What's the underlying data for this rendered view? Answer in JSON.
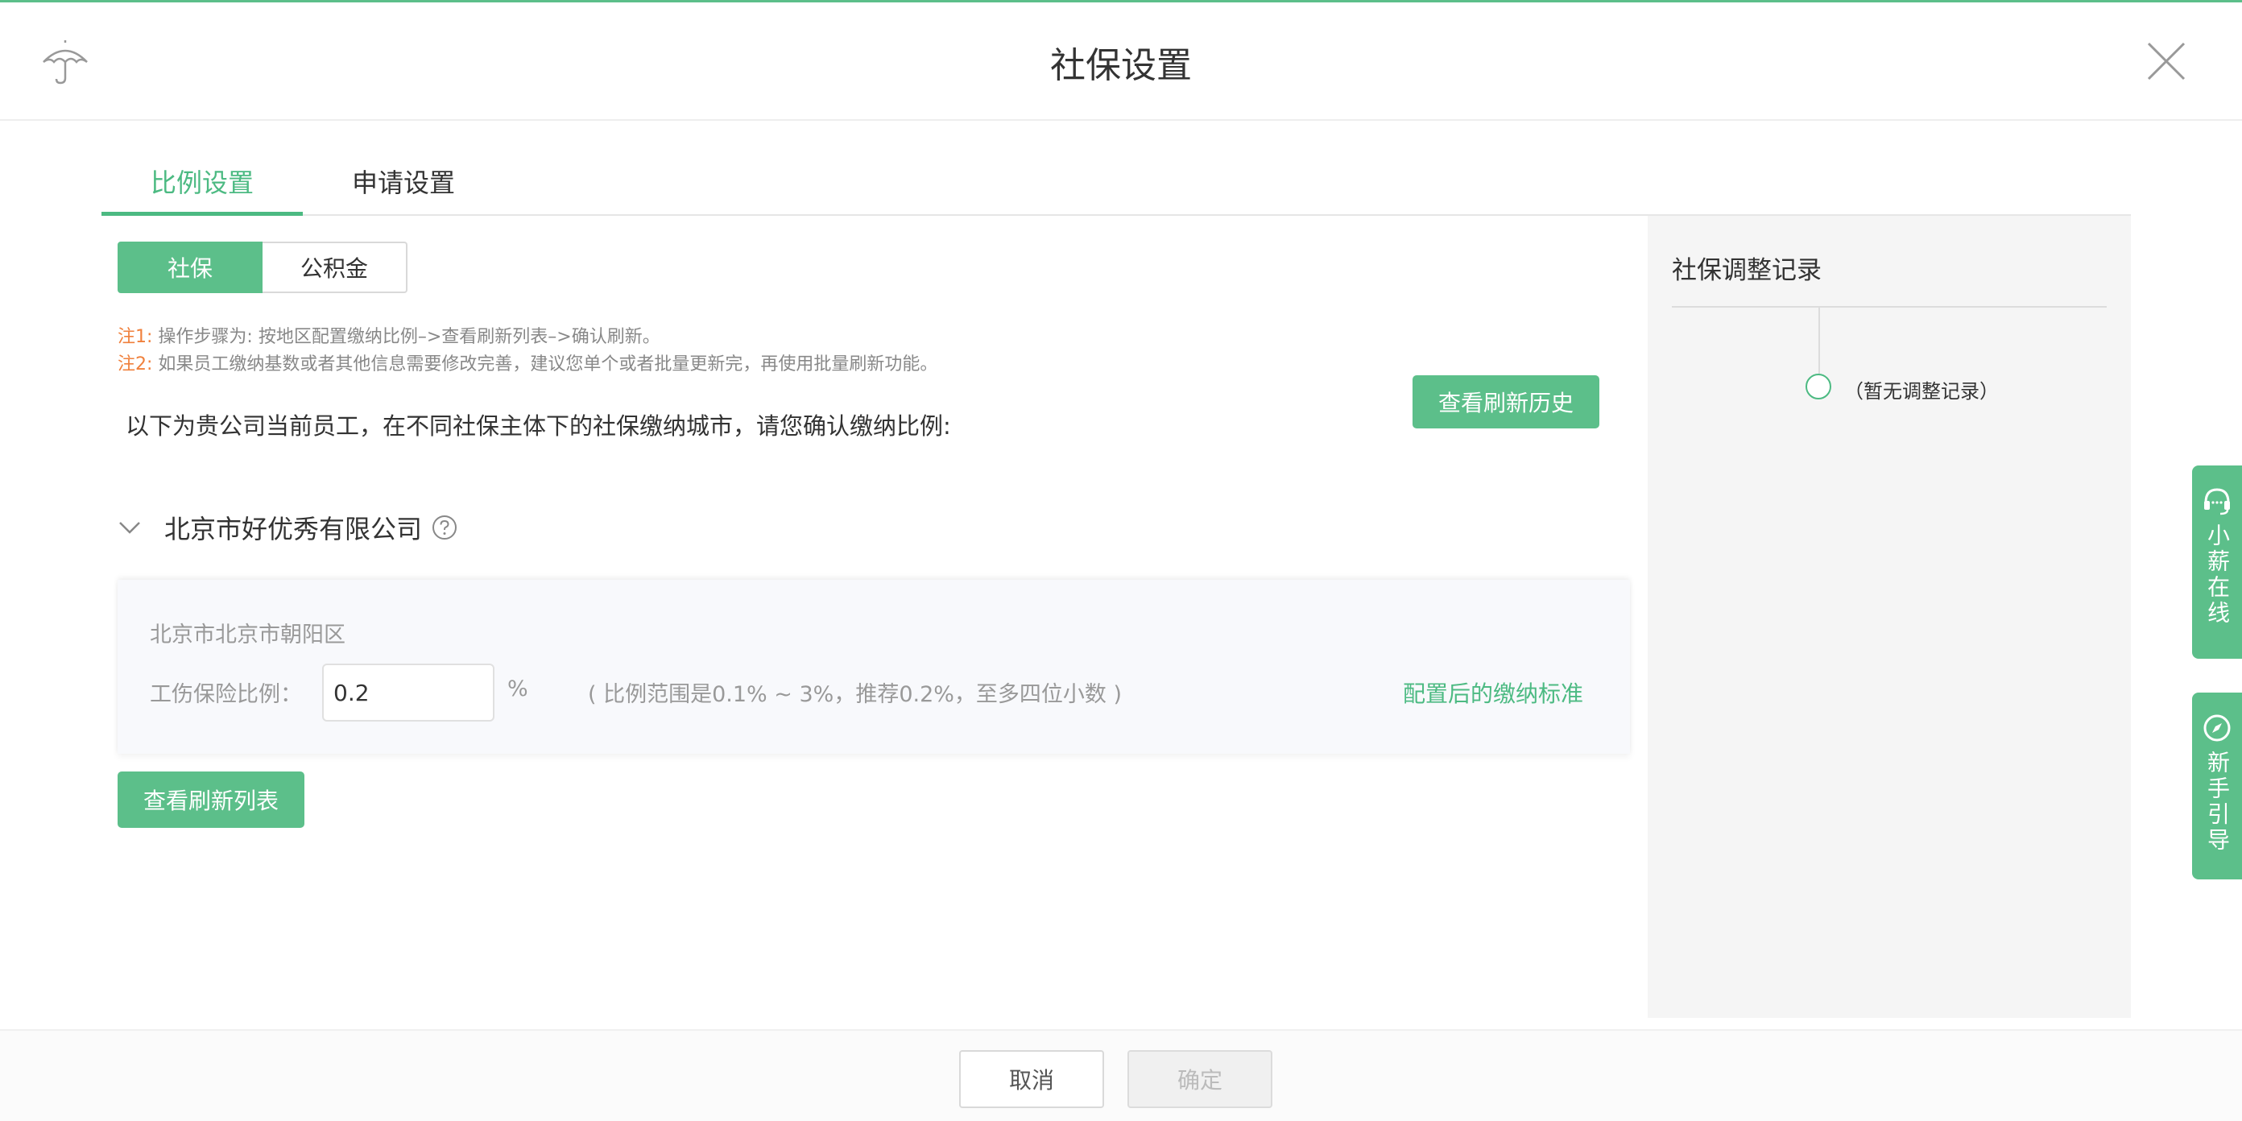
{
  "header": {
    "title": "社保设置"
  },
  "tabs": [
    {
      "label": "比例设置"
    },
    {
      "label": "申请设置"
    }
  ],
  "segment": {
    "options": [
      "社保",
      "公积金"
    ],
    "selected": "社保"
  },
  "notes": [
    {
      "tag": "注1:",
      "text": " 操作步骤为: 按地区配置缴纳比例–>查看刷新列表–>确认刷新。"
    },
    {
      "tag": "注2:",
      "text": " 如果员工缴纳基数或者其他信息需要修改完善，建议您单个或者批量更新完，再使用批量刷新功能。"
    }
  ],
  "intro": "以下为贵公司当前员工，在不同社保主体下的社保缴纳城市，请您确认缴纳比例:",
  "history_button": "查看刷新历史",
  "company": {
    "name": "北京市好优秀有限公司"
  },
  "card": {
    "city": "北京市北京市朝阳区",
    "label": "工伤保险比例：",
    "value": "0.2",
    "unit": "%",
    "range": "( 比例范围是0.1% ~ 3%，推荐0.2%，至多四位小数 )",
    "link": "配置后的缴纳标准"
  },
  "refresh_list_button": "查看刷新列表",
  "side": {
    "title": "社保调整记录",
    "empty": "（暂无调整记录）"
  },
  "float": [
    {
      "label": "小薪在线",
      "icon": "headset-icon"
    },
    {
      "label": "新手引导",
      "icon": "compass-icon"
    }
  ],
  "footer": {
    "cancel": "取消",
    "confirm": "确定"
  },
  "colors": {
    "accent": "#5cbf8a",
    "note_tag": "#f0803c"
  }
}
